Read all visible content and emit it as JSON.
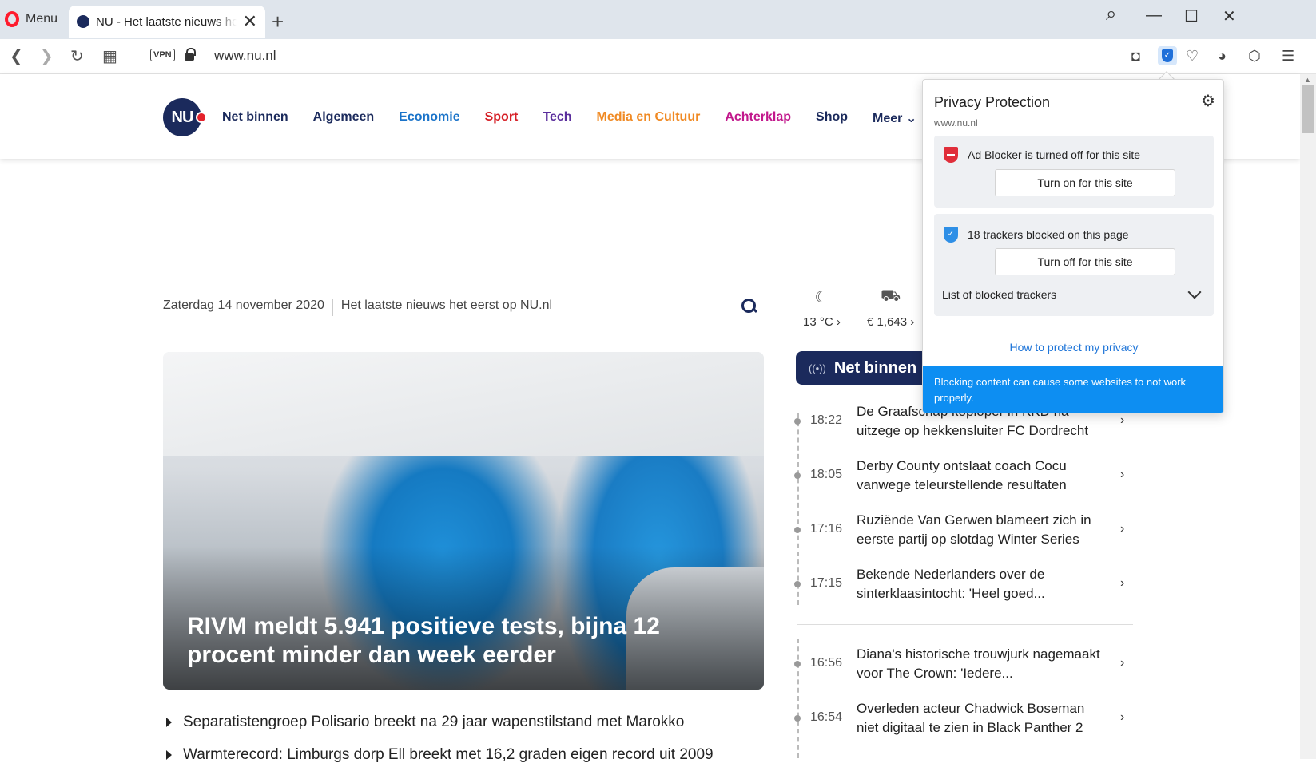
{
  "browser": {
    "menu_label": "Menu",
    "tab_title": "NU - Het laatste nieuws het eerst op NU.nl",
    "tab_close": "✕",
    "new_tab": "+",
    "url": "www.nu.nl",
    "vpn_label": "VPN",
    "controls": {
      "search": "⌕",
      "minimize": "—",
      "maximize": "☐",
      "close": "✕"
    },
    "nav": {
      "back": "❮",
      "forward": "❯",
      "reload": "↻",
      "speed_dial": "▦"
    },
    "tools": {
      "camera": "◘",
      "heart": "♡",
      "flow": "◕",
      "cube": "⬡",
      "easy_setup": "☰"
    }
  },
  "site": {
    "logo_text": "NU",
    "nav": [
      {
        "label": "Net binnen",
        "color": "#1b2a5c"
      },
      {
        "label": "Algemeen",
        "color": "#1b2a5c"
      },
      {
        "label": "Economie",
        "color": "#1a73c9"
      },
      {
        "label": "Sport",
        "color": "#d61f26"
      },
      {
        "label": "Tech",
        "color": "#5a2d9c"
      },
      {
        "label": "Media en Cultuur",
        "color": "#f08a24"
      },
      {
        "label": "Achterklap",
        "color": "#c2188c"
      },
      {
        "label": "Shop",
        "color": "#1b2a5c"
      },
      {
        "label": "Meer ⌄",
        "color": "#1b2a5c"
      }
    ],
    "date": "Zaterdag 14 november 2020",
    "tagline": "Het laatste nieuws het eerst op NU.nl",
    "weather": {
      "icon": "☾",
      "value": "13 °C ›"
    },
    "traffic": {
      "icon": "⛟",
      "value": "€ 1,643 ›"
    },
    "hero_title": "RIVM meldt 5.941 positieve tests, bijna 12 procent minder dan week eerder",
    "headlines": [
      "Separatistengroep Polisario breekt na 29 jaar wapenstilstand met Marokko",
      "Warmterecord: Limburgs dorp Ell breekt met 16,2 graden eigen record uit 2009"
    ],
    "net_binnen": {
      "live_icon": "((•))",
      "title": "Net binnen",
      "items": [
        {
          "time": "18:22",
          "text": "De Graafschap koploper in KKD na uitzege op hekkensluiter FC Dordrecht"
        },
        {
          "time": "18:05",
          "text": "Derby County ontslaat coach Cocu vanwege teleurstellende resultaten"
        },
        {
          "time": "17:16",
          "text": "Ruziënde Van Gerwen blameert zich in eerste partij op slotdag Winter Series"
        },
        {
          "time": "17:15",
          "text": "Bekende Nederlanders over de sinterklaasintocht: 'Heel goed..."
        },
        {
          "time": "16:56",
          "text": "Diana's historische trouwjurk nagemaakt voor The Crown: 'Iedere..."
        },
        {
          "time": "16:54",
          "text": "Overleden acteur Chadwick Boseman niet digitaal te zien in Black Panther 2"
        }
      ]
    }
  },
  "privacy": {
    "title": "Privacy Protection",
    "site": "www.nu.nl",
    "gear": "⚙",
    "ad_blocker_status": "Ad Blocker is turned off for this site",
    "ad_blocker_button": "Turn on for this site",
    "trackers_status": "18 trackers blocked on this page",
    "trackers_button": "Turn off for this site",
    "trackers_list": "List of blocked trackers",
    "help_link": "How to protect my privacy",
    "warning": "Blocking content can cause some websites to not work properly."
  },
  "colors": {
    "brand": "#1b2a5c",
    "opera_red": "#ff1b2d",
    "warning_blue": "#0d8ef2",
    "link_blue": "#1d74d8"
  }
}
